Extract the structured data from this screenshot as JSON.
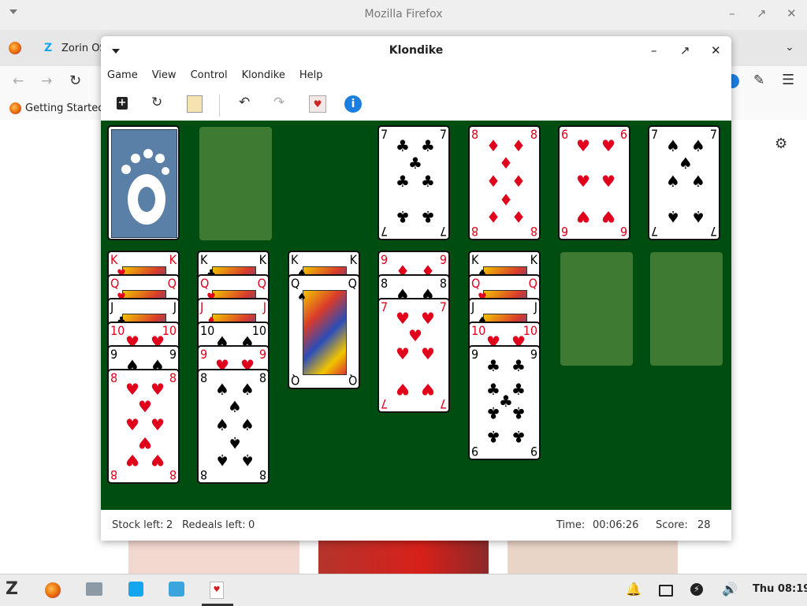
{
  "firefox": {
    "window_title": "Mozilla Firefox",
    "tab_label": "Zorin OS",
    "bookmark": "Getting Started"
  },
  "klondike": {
    "title": "Klondike",
    "menu": [
      "Game",
      "View",
      "Control",
      "Klondike",
      "Help"
    ],
    "status": {
      "stock_label": "Stock left:",
      "stock_value": "2",
      "redeals_label": "Redeals left:",
      "redeals_value": "0",
      "time_label": "Time:",
      "time_value": "00:06:26",
      "score_label": "Score:",
      "score_value": "28"
    },
    "stock_card_back": "gnome-foot-logo",
    "foundations": [
      {
        "rank": "7",
        "suit": "clubs",
        "color": "black"
      },
      {
        "rank": "8",
        "suit": "diamonds",
        "color": "red"
      },
      {
        "rank": "6",
        "suit": "hearts",
        "color": "red"
      },
      {
        "rank": "7",
        "suit": "spades",
        "color": "black"
      }
    ],
    "tableau": [
      {
        "cards": [
          {
            "rank": "K",
            "suit": "hearts",
            "color": "red"
          },
          {
            "rank": "Q",
            "suit": "hearts",
            "color": "red"
          },
          {
            "rank": "J",
            "suit": "clubs",
            "color": "black"
          },
          {
            "rank": "10",
            "suit": "hearts",
            "color": "red"
          },
          {
            "rank": "9",
            "suit": "spades",
            "color": "black"
          },
          {
            "rank": "8",
            "suit": "hearts",
            "color": "red"
          }
        ]
      },
      {
        "cards": [
          {
            "rank": "K",
            "suit": "clubs",
            "color": "black"
          },
          {
            "rank": "Q",
            "suit": "hearts",
            "color": "red"
          },
          {
            "rank": "J",
            "suit": "diamonds",
            "color": "red"
          },
          {
            "rank": "10",
            "suit": "spades",
            "color": "black"
          },
          {
            "rank": "9",
            "suit": "hearts",
            "color": "red"
          },
          {
            "rank": "8",
            "suit": "spades",
            "color": "black"
          }
        ]
      },
      {
        "cards": [
          {
            "rank": "K",
            "suit": "spades",
            "color": "black"
          },
          {
            "rank": "Q",
            "suit": "spades",
            "color": "black"
          }
        ]
      },
      {
        "cards": [
          {
            "rank": "9",
            "suit": "diamonds",
            "color": "red"
          },
          {
            "rank": "8",
            "suit": "spades",
            "color": "black"
          },
          {
            "rank": "7",
            "suit": "hearts",
            "color": "red"
          }
        ]
      },
      {
        "cards": [
          {
            "rank": "K",
            "suit": "spades",
            "color": "black"
          },
          {
            "rank": "Q",
            "suit": "hearts",
            "color": "red"
          },
          {
            "rank": "J",
            "suit": "spades",
            "color": "black"
          },
          {
            "rank": "10",
            "suit": "hearts",
            "color": "red"
          },
          {
            "rank": "9",
            "suit": "clubs",
            "color": "black"
          }
        ]
      },
      {
        "cards": []
      },
      {
        "cards": []
      }
    ]
  },
  "taskbar": {
    "clock": "Thu 08:19"
  },
  "colors": {
    "felt": "#004d12",
    "empty_slot": "#3f7a32",
    "red_suit": "#e0001b",
    "info_blue": "#1c7fe0"
  }
}
